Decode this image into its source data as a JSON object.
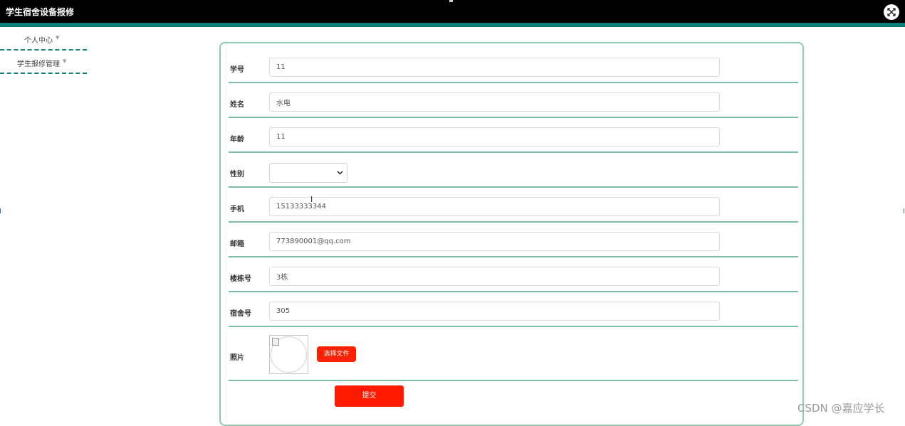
{
  "window": {
    "title": "学生宿舍设备报修",
    "close_icon": "expand-arrows-icon"
  },
  "sidebar": {
    "items": [
      {
        "label": "个人中心"
      },
      {
        "label": "学生报修管理"
      }
    ]
  },
  "form": {
    "fields": [
      {
        "label": "学号",
        "value": "11"
      },
      {
        "label": "姓名",
        "value": "水电"
      },
      {
        "label": "年龄",
        "value": "11"
      },
      {
        "label": "性别",
        "value": ""
      },
      {
        "label": "手机",
        "value": "15133333344"
      },
      {
        "label": "邮箱",
        "value": "773890001@qq.com"
      },
      {
        "label": "楼栋号",
        "value": "3栋"
      },
      {
        "label": "宿舍号",
        "value": "305"
      },
      {
        "label": "照片"
      }
    ],
    "file_button": "选择文件",
    "submit_button": "提交"
  },
  "colors": {
    "topbar": "#000000",
    "accent_teal": "#107c76",
    "button_red": "#ff2000"
  },
  "watermark": "CSDN @嘉应学长"
}
